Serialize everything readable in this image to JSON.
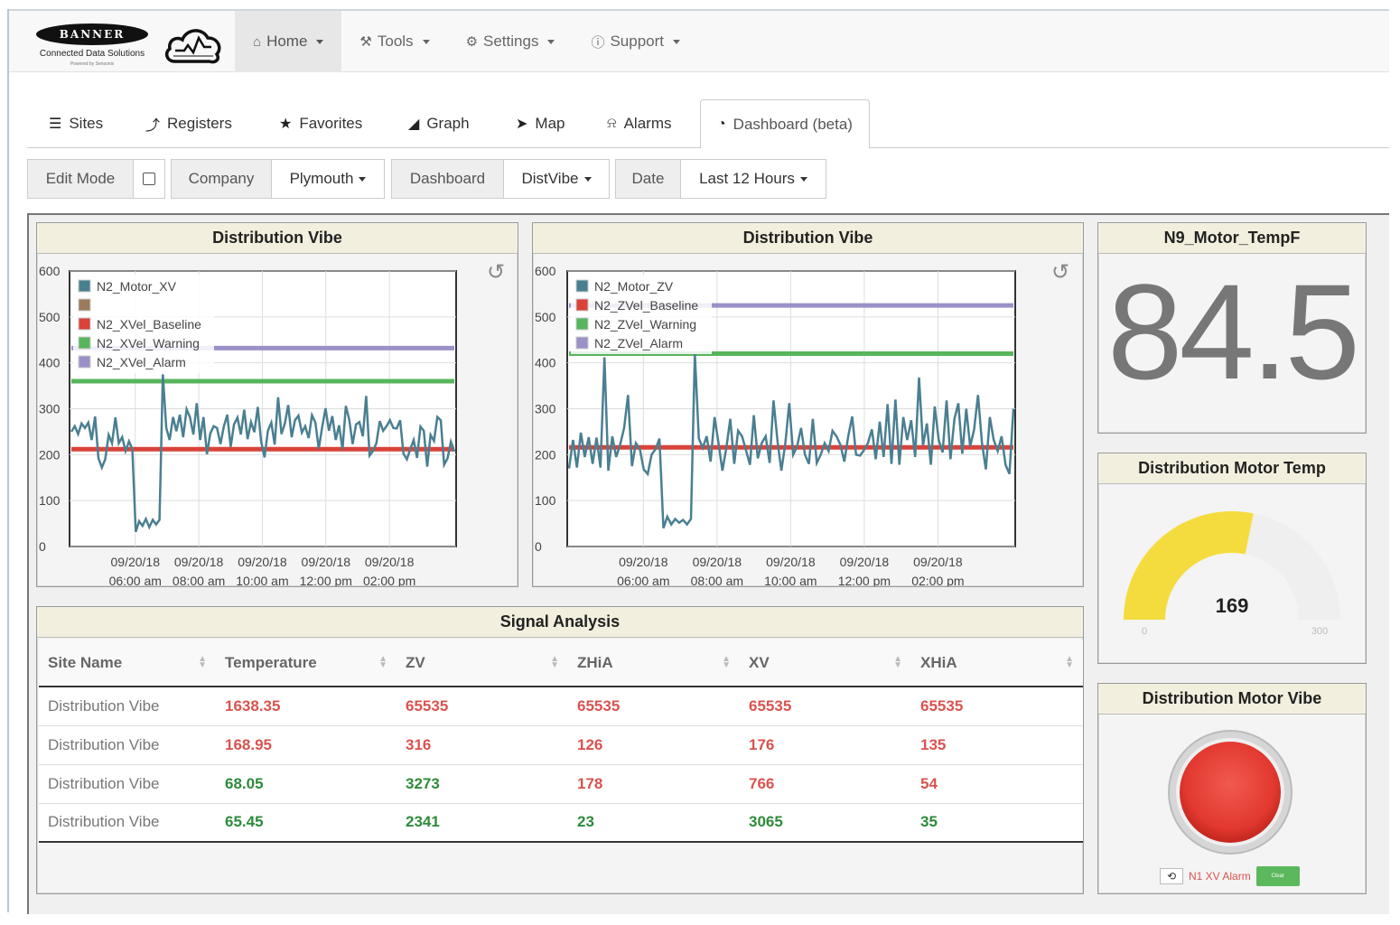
{
  "brand": {
    "name": "BANNER",
    "subtitle": "Connected Data Solutions",
    "tiny": "Powered by Sensonix"
  },
  "nav": {
    "items": [
      {
        "label": "Home",
        "icon": "home-icon",
        "active": true
      },
      {
        "label": "Tools",
        "icon": "wrench-icon",
        "active": false
      },
      {
        "label": "Settings",
        "icon": "gears-icon",
        "active": false
      },
      {
        "label": "Support",
        "icon": "info-circle-icon",
        "active": false
      }
    ]
  },
  "tabs": [
    {
      "label": "Sites",
      "icon": "list-icon"
    },
    {
      "label": "Registers",
      "icon": "line-chart-icon"
    },
    {
      "label": "Favorites",
      "icon": "star-icon"
    },
    {
      "label": "Graph",
      "icon": "area-chart-icon"
    },
    {
      "label": "Map",
      "icon": "location-arrow-icon"
    },
    {
      "label": "Alarms",
      "icon": "bell-icon"
    },
    {
      "label": "Dashboard (beta)",
      "icon": "dashboard-icon",
      "active": true
    }
  ],
  "toolbar": {
    "edit_mode": "Edit Mode",
    "company_label": "Company",
    "company_value": "Plymouth",
    "dashboard_label": "Dashboard",
    "dashboard_value": "DistVibe",
    "date_label": "Date",
    "date_value": "Last 12 Hours"
  },
  "panels": {
    "chart1_title": "Distribution Vibe",
    "chart2_title": "Distribution Vibe",
    "value_title": "N9_Motor_TempF",
    "value": "84.5",
    "gauge_title": "Distribution Motor Temp",
    "indicator_title": "Distribution Motor Vibe",
    "table_title": "Signal Analysis"
  },
  "chart_data": [
    {
      "type": "line",
      "title": "Distribution Vibe",
      "ylim": [
        0,
        600
      ],
      "yticks": [
        "0",
        "100",
        "200",
        "300",
        "400",
        "500",
        "600"
      ],
      "xticks": [
        {
          "l1": "09/20/18",
          "l2": "06:00 am"
        },
        {
          "l1": "09/20/18",
          "l2": "08:00 am"
        },
        {
          "l1": "09/20/18",
          "l2": "10:00 am"
        },
        {
          "l1": "09/20/18",
          "l2": "12:00 pm"
        },
        {
          "l1": "09/20/18",
          "l2": "02:00 pm"
        }
      ],
      "legend": [
        {
          "name": "N2_Motor_XV",
          "color": "#4a7f91"
        },
        {
          "name": "",
          "color": "#9b7b5c"
        },
        {
          "name": "N2_XVel_Baseline",
          "color": "#d9433a"
        },
        {
          "name": "N2_XVel_Warning",
          "color": "#57b55c"
        },
        {
          "name": "N2_XVel_Alarm",
          "color": "#9b90c8"
        }
      ],
      "baseline": 212,
      "warning": 360,
      "alarm": 432,
      "series": [
        250,
        262,
        245,
        268,
        258,
        270,
        232,
        283,
        192,
        172,
        190,
        243,
        225,
        281,
        225,
        238,
        208,
        229,
        212,
        32,
        55,
        45,
        60,
        42,
        58,
        48,
        58,
        375,
        258,
        232,
        282,
        251,
        287,
        238,
        299,
        282,
        244,
        312,
        232,
        282,
        201,
        246,
        262,
        258,
        223,
        261,
        287,
        217,
        266,
        281,
        244,
        298,
        234,
        271,
        249,
        304,
        229,
        194,
        252,
        270,
        222,
        325,
        245,
        268,
        308,
        238,
        275,
        285,
        248,
        262,
        236,
        286,
        270,
        213,
        260,
        301,
        252,
        284,
        232,
        264,
        212,
        306,
        276,
        223,
        266,
        271,
        240,
        328,
        198,
        208,
        225,
        273,
        252,
        262,
        275,
        258,
        257,
        275,
        202,
        190,
        212,
        232,
        193,
        261,
        252,
        174,
        243,
        230,
        282,
        275,
        178,
        192,
        228,
        207
      ]
    },
    {
      "type": "line",
      "title": "Distribution Vibe",
      "ylim": [
        0,
        600
      ],
      "yticks": [
        "0",
        "100",
        "200",
        "300",
        "400",
        "500",
        "600"
      ],
      "xticks": [
        {
          "l1": "09/20/18",
          "l2": "06:00 am"
        },
        {
          "l1": "09/20/18",
          "l2": "08:00 am"
        },
        {
          "l1": "09/20/18",
          "l2": "10:00 am"
        },
        {
          "l1": "09/20/18",
          "l2": "12:00 pm"
        },
        {
          "l1": "09/20/18",
          "l2": "02:00 pm"
        }
      ],
      "legend": [
        {
          "name": "N2_Motor_ZV",
          "color": "#4a7f91"
        },
        {
          "name": "N2_ZVel_Baseline",
          "color": "#d9433a"
        },
        {
          "name": "N2_ZVel_Warning",
          "color": "#57b55c"
        },
        {
          "name": "N2_ZVel_Alarm",
          "color": "#9b90c8"
        }
      ],
      "baseline": 216,
      "warning": 420,
      "alarm": 525,
      "series": [
        170,
        232,
        172,
        248,
        195,
        238,
        180,
        237,
        172,
        412,
        165,
        240,
        195,
        222,
        258,
        330,
        175,
        225,
        212,
        168,
        158,
        200,
        212,
        235,
        40,
        65,
        48,
        60,
        52,
        58,
        48,
        60,
        420,
        235,
        215,
        240,
        185,
        282,
        225,
        165,
        215,
        278,
        180,
        252,
        240,
        210,
        178,
        286,
        192,
        225,
        240,
        182,
        318,
        230,
        165,
        225,
        312,
        200,
        218,
        258,
        200,
        180,
        278,
        182,
        200,
        225,
        208,
        252,
        240,
        222,
        185,
        240,
        283,
        200,
        198,
        210,
        225,
        255,
        190,
        272,
        195,
        310,
        180,
        320,
        178,
        282,
        232,
        275,
        195,
        368,
        220,
        268,
        178,
        305,
        232,
        205,
        318,
        190,
        278,
        312,
        202,
        300,
        218,
        255,
        330,
        225,
        168,
        282,
        232,
        208,
        240,
        178,
        158,
        300
      ]
    }
  ],
  "gauge": {
    "value": 169,
    "min": 0,
    "max": 300,
    "fill_color": "#f5dc3e",
    "track_color": "#efefef"
  },
  "indicator": {
    "label": "N1 XV Alarm",
    "clear_label": "Clear",
    "color": "#e8413a"
  },
  "table": {
    "columns": [
      "Site Name",
      "Temperature",
      "ZV",
      "ZHiA",
      "XV",
      "XHiA"
    ],
    "rows": [
      {
        "site": "Distribution Vibe",
        "cells": [
          {
            "v": "1638.35",
            "s": "red"
          },
          {
            "v": "65535",
            "s": "red"
          },
          {
            "v": "65535",
            "s": "red"
          },
          {
            "v": "65535",
            "s": "red"
          },
          {
            "v": "65535",
            "s": "red"
          }
        ]
      },
      {
        "site": "Distribution Vibe",
        "cells": [
          {
            "v": "168.95",
            "s": "red"
          },
          {
            "v": "316",
            "s": "red"
          },
          {
            "v": "126",
            "s": "red"
          },
          {
            "v": "176",
            "s": "red"
          },
          {
            "v": "135",
            "s": "red"
          }
        ]
      },
      {
        "site": "Distribution Vibe",
        "cells": [
          {
            "v": "68.05",
            "s": "green"
          },
          {
            "v": "3273",
            "s": "green"
          },
          {
            "v": "178",
            "s": "red"
          },
          {
            "v": "766",
            "s": "red"
          },
          {
            "v": "54",
            "s": "red"
          }
        ]
      },
      {
        "site": "Distribution Vibe",
        "cells": [
          {
            "v": "65.45",
            "s": "green"
          },
          {
            "v": "2341",
            "s": "green"
          },
          {
            "v": "23",
            "s": "green"
          },
          {
            "v": "3065",
            "s": "green"
          },
          {
            "v": "35",
            "s": "green"
          }
        ]
      }
    ]
  }
}
